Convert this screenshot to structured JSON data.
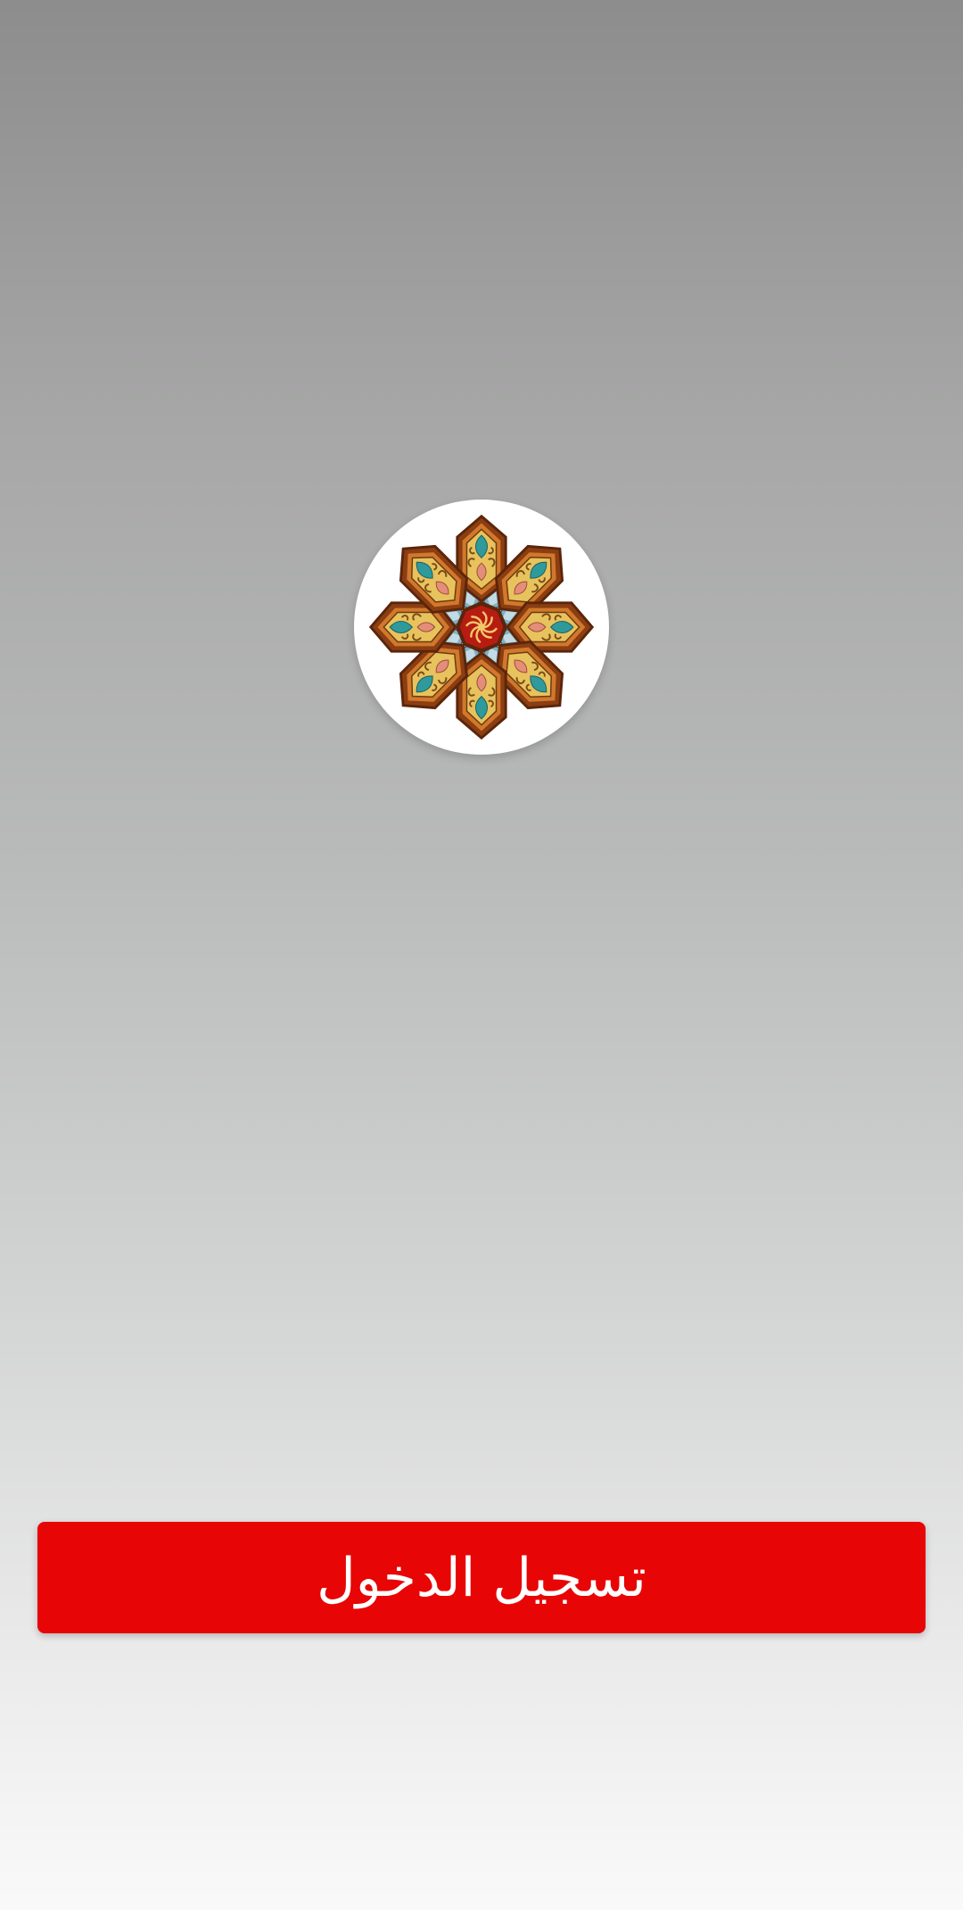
{
  "app": {
    "logo_icon": "islamic-geometric-star-emblem-icon"
  },
  "login": {
    "button_label": "تسجيل الدخول"
  },
  "colors": {
    "background_top": "#8c8d8c",
    "background_bottom": "#fafafa",
    "button": "#e80505",
    "button_text": "#ffffff",
    "logo_circle": "#ffffff"
  }
}
